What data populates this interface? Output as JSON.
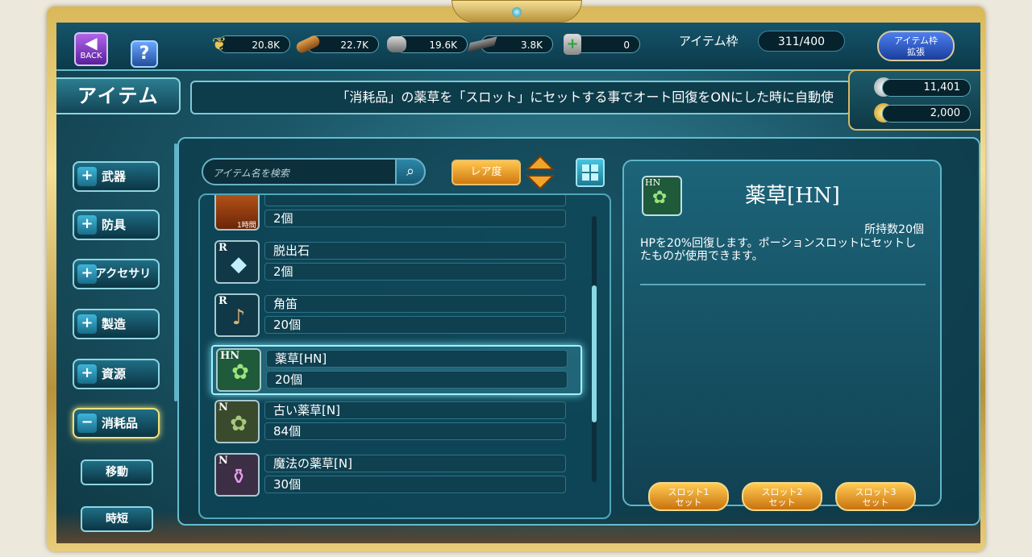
{
  "topbar": {
    "back_label": "BACK",
    "help_label": "?",
    "resources": [
      {
        "icon": "wheat-icon",
        "value": "20.8K"
      },
      {
        "icon": "wood-log-icon",
        "value": "22.7K"
      },
      {
        "icon": "stone-icon",
        "value": "19.6K"
      },
      {
        "icon": "iron-ingot-icon",
        "value": "3.8K"
      },
      {
        "icon": "potion-jar-icon",
        "value": "0"
      }
    ],
    "slot_label": "アイテム枠",
    "slot_value": "311/400",
    "expand_label_1": "アイテム枠",
    "expand_label_2": "拡張"
  },
  "title": "アイテム",
  "marquee": "「消耗品」の薬草を「スロット」にセットする事でオート回復をONにした時に自動使",
  "currency": {
    "silver": "11,401",
    "gold": "2,000"
  },
  "sidebar": {
    "items": [
      {
        "label": "武器",
        "sign": "+"
      },
      {
        "label": "防具",
        "sign": "+"
      },
      {
        "label": "アクセサリ",
        "sign": "+"
      },
      {
        "label": "製造",
        "sign": "+"
      },
      {
        "label": "資源",
        "sign": "+"
      },
      {
        "label": "消耗品",
        "sign": "−"
      }
    ],
    "subitems": [
      {
        "label": "移動"
      },
      {
        "label": "時短"
      }
    ]
  },
  "search": {
    "placeholder": "アイテム名を検索"
  },
  "sort": {
    "label": "レア度"
  },
  "list": {
    "items": [
      {
        "rank": "",
        "name": "",
        "count": "2個",
        "icon": "scroll-icon",
        "badge": "1時間"
      },
      {
        "rank": "R",
        "name": "脱出石",
        "count": "2個",
        "icon": "crystal-icon"
      },
      {
        "rank": "R",
        "name": "角笛",
        "count": "20個",
        "icon": "horn-icon"
      },
      {
        "rank": "HN",
        "name": "薬草[HN]",
        "count": "20個",
        "icon": "herb-icon"
      },
      {
        "rank": "N",
        "name": "古い薬草[N]",
        "count": "84個",
        "icon": "herb-icon"
      },
      {
        "rank": "N",
        "name": "魔法の薬草[N]",
        "count": "30個",
        "icon": "potion-icon"
      }
    ]
  },
  "detail": {
    "rank": "HN",
    "name": "薬草[HN]",
    "count": "所持数20個",
    "description": "HPを20%回復します。ポーションスロットにセットしたものが使用できます。",
    "slots": [
      {
        "line1": "スロット1",
        "line2": "セット"
      },
      {
        "line1": "スロット2",
        "line2": "セット"
      },
      {
        "line1": "スロット3",
        "line2": "セット"
      }
    ]
  }
}
